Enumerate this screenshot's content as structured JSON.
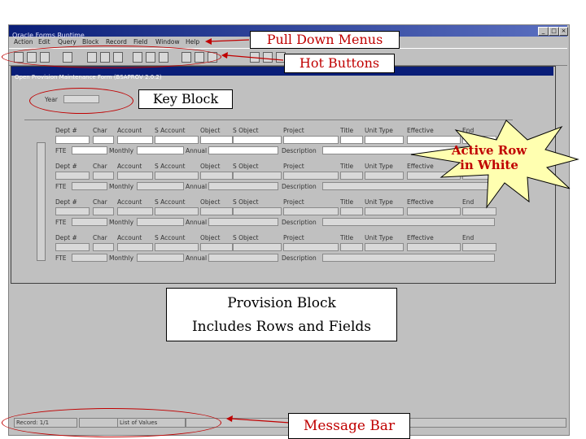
{
  "window": {
    "title": "Oracle Forms Runtime",
    "controls": [
      "_",
      "□",
      "×"
    ]
  },
  "menu": {
    "items": [
      "Action",
      "Edit",
      "Query",
      "Block",
      "Record",
      "Field",
      "Window",
      "Help"
    ]
  },
  "form": {
    "title": "Open Provision Maintenance Form (BSAPROV 2.0.2)",
    "key_block": {
      "year_label": "Year"
    },
    "columns": [
      "Dept #",
      "Char",
      "Account",
      "S Account",
      "Object",
      "S Object",
      "Project",
      "Title",
      "Unit Type",
      "Effective",
      "End"
    ],
    "row_labels": {
      "fte": "FTE",
      "monthly": "Monthly",
      "annual": "Annual",
      "description": "Description"
    }
  },
  "message_bar": {
    "record": "Record: 1/1",
    "list": "List of Values"
  },
  "callouts": {
    "menus": "Pull Down Menus",
    "hot_buttons": "Hot Buttons",
    "key_block": "Key Block",
    "active_row_line1": "Active Row",
    "active_row_line2": "in White",
    "provision_line1": "Provision Block",
    "provision_line2": "Includes Rows and Fields",
    "message_bar": "Message Bar"
  },
  "colors": {
    "callout_red": "#c00000",
    "star_fill": "#ffffb0",
    "title_blue": "#0a1e78"
  }
}
